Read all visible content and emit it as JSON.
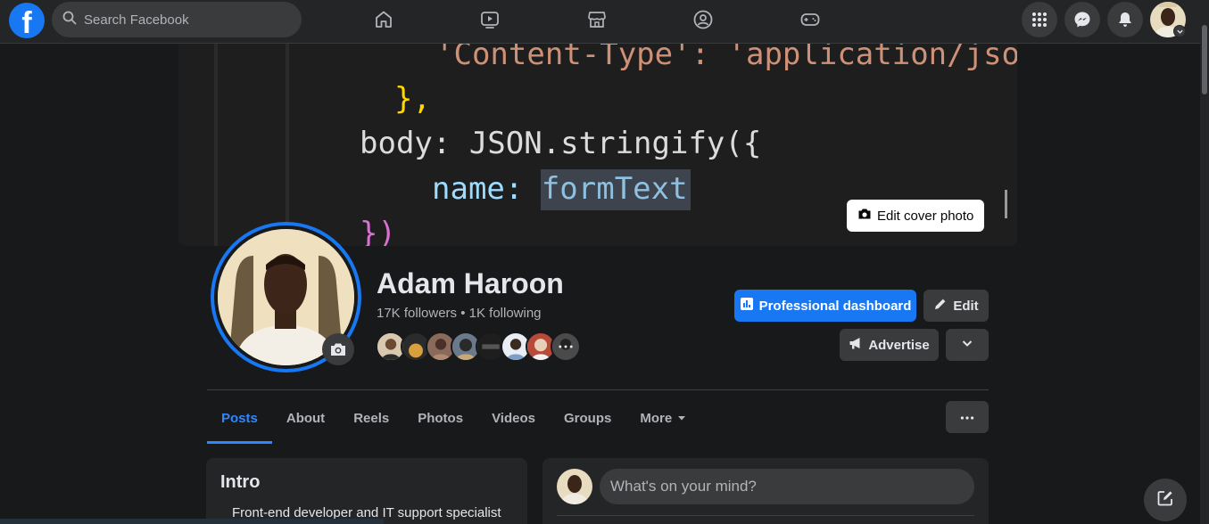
{
  "nav": {
    "logo_letter": "f",
    "search_placeholder": "Search Facebook",
    "icons": [
      "home-icon",
      "video-icon",
      "marketplace-icon",
      "groups-icon",
      "gaming-icon"
    ],
    "right_icons": [
      "menu-grid-icon",
      "messenger-icon",
      "notifications-icon"
    ]
  },
  "cover": {
    "code_lines": [
      "'Content-Type': 'application/json",
      "},",
      "body: JSON.stringify({",
      "name: formText",
      "})"
    ],
    "edit_label": "Edit cover photo"
  },
  "profile": {
    "name": "Adam Haroon",
    "followers": "17K followers • 1K following",
    "friend_count_shown": 8
  },
  "actions": {
    "dashboard": "Professional dashboard",
    "edit": "Edit",
    "advertise": "Advertise"
  },
  "tabs": [
    {
      "label": "Posts",
      "active": true
    },
    {
      "label": "About",
      "active": false
    },
    {
      "label": "Reels",
      "active": false
    },
    {
      "label": "Photos",
      "active": false
    },
    {
      "label": "Videos",
      "active": false
    },
    {
      "label": "Groups",
      "active": false
    },
    {
      "label": "More",
      "active": false
    }
  ],
  "intro": {
    "title": "Intro",
    "bio": "Front-end developer and IT support specialist"
  },
  "composer": {
    "placeholder": "What's on your mind?"
  },
  "colors": {
    "accent": "#1877f2",
    "tab_active": "#2d88ff",
    "background": "#18191a",
    "surface": "#242526"
  }
}
